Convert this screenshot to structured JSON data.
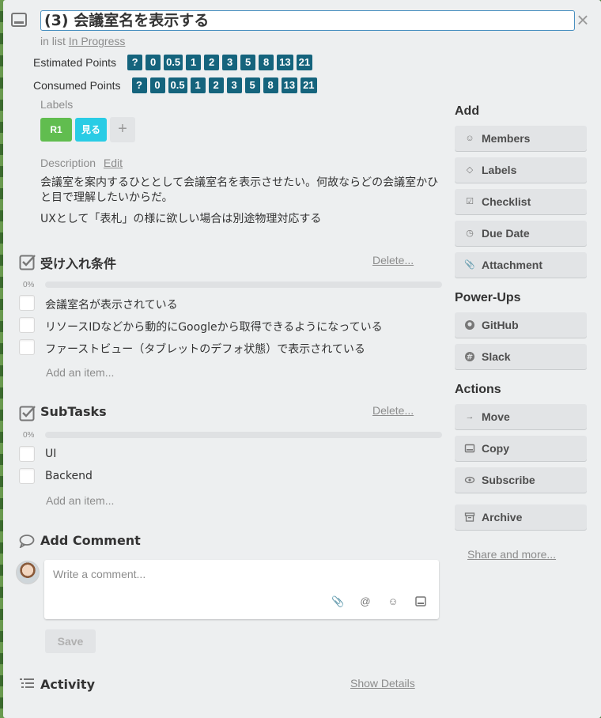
{
  "card": {
    "title": "(3) 会議室名を表示する",
    "in_list_prefix": "in list",
    "list_name": "In Progress",
    "close_symbol": "×"
  },
  "estimated": {
    "label": "Estimated Points",
    "options": [
      "?",
      "0",
      "0.5",
      "1",
      "2",
      "3",
      "5",
      "8",
      "13",
      "21"
    ]
  },
  "consumed": {
    "label": "Consumed Points",
    "options": [
      "?",
      "0",
      "0.5",
      "1",
      "2",
      "3",
      "5",
      "8",
      "13",
      "21"
    ]
  },
  "labels": {
    "heading": "Labels",
    "items": [
      {
        "text": "R1",
        "color": "#61bd4f"
      },
      {
        "text": "見る",
        "color": "#29cce5"
      }
    ],
    "add_symbol": "+"
  },
  "description": {
    "heading": "Description",
    "edit_label": "Edit",
    "paragraphs": [
      "会議室を案内するひととして会議室名を表示させたい。何故ならどの会議室かひと目で理解したいからだ。",
      "UXとして「表札」の様に欲しい場合は別途物理対応する"
    ]
  },
  "checklists": [
    {
      "title": "受け入れ条件",
      "delete_label": "Delete...",
      "progress": "0%",
      "items": [
        "会議室名が表示されている",
        "リソースIDなどから動的にGoogleから取得できるようになっている",
        "ファーストビュー（タブレットのデフォ状態）で表示されている"
      ],
      "add_item_label": "Add an item..."
    },
    {
      "title": "SubTasks",
      "delete_label": "Delete...",
      "progress": "0%",
      "items": [
        "UI",
        "Backend"
      ],
      "add_item_label": "Add an item..."
    }
  ],
  "comment": {
    "heading": "Add Comment",
    "placeholder": "Write a comment...",
    "save_label": "Save"
  },
  "activity": {
    "heading": "Activity",
    "show_details_label": "Show Details"
  },
  "sidebar": {
    "add_heading": "Add",
    "add_buttons": [
      {
        "label": "Members",
        "icon": "person-icon"
      },
      {
        "label": "Labels",
        "icon": "tag-icon"
      },
      {
        "label": "Checklist",
        "icon": "checkbox-icon"
      },
      {
        "label": "Due Date",
        "icon": "clock-icon"
      },
      {
        "label": "Attachment",
        "icon": "paperclip-icon"
      }
    ],
    "powerups_heading": "Power-Ups",
    "powerups": [
      {
        "label": "GitHub",
        "icon": "github-icon"
      },
      {
        "label": "Slack",
        "icon": "slack-icon"
      }
    ],
    "actions_heading": "Actions",
    "actions": [
      {
        "label": "Move",
        "icon": "arrow-right-icon"
      },
      {
        "label": "Copy",
        "icon": "card-icon"
      },
      {
        "label": "Subscribe",
        "icon": "eye-icon"
      },
      {
        "label": "Archive",
        "icon": "archive-icon"
      }
    ],
    "share_label": "Share and more..."
  }
}
